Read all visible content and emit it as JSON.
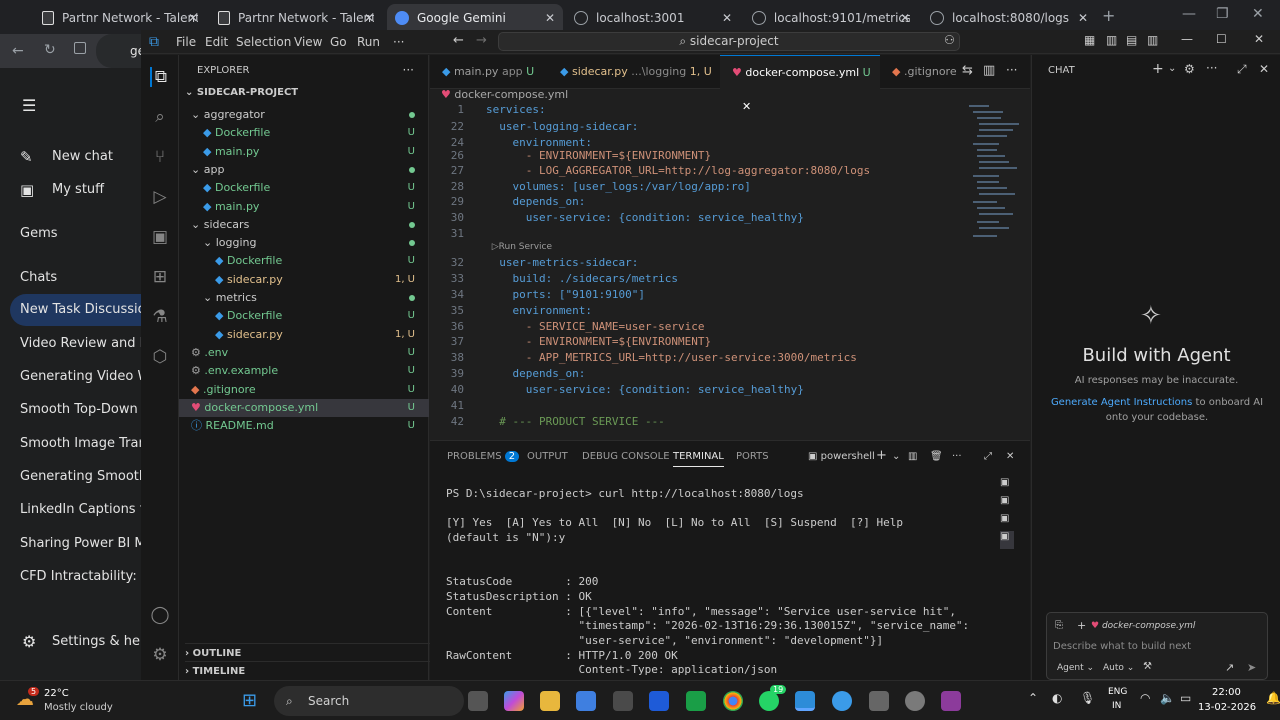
{
  "browser": {
    "tabs": [
      {
        "label": "Partnr Network - Talent Lay",
        "color": "#ffffff"
      },
      {
        "label": "Partnr Network - Talent Lay",
        "color": "#ffffff"
      },
      {
        "label": "Google Gemini",
        "color": "#4e8cf5"
      },
      {
        "label": "localhost:3001",
        "color": "#9aa0a6"
      },
      {
        "label": "localhost:9101/metrics",
        "color": "#9aa0a6"
      },
      {
        "label": "localhost:8080/logs",
        "color": "#9aa0a6"
      }
    ],
    "new_tab": "+",
    "address_partial": "ge"
  },
  "gemini": {
    "items": [
      "New chat",
      "My stuff",
      "Gems",
      "Chats"
    ],
    "chats": [
      "New Task Discussion",
      "Video Review and Enh",
      "Generating Video With",
      "Smooth Top-Down to",
      "Smooth Image Transiti",
      "Generating Smooth Ca",
      "LinkedIn Captions for",
      "Sharing Power BI Mod",
      "CFD Intractability: Gri"
    ],
    "settings": "Settings & help"
  },
  "vscode": {
    "menu": [
      "File",
      "Edit",
      "Selection",
      "View",
      "Go",
      "Run",
      "···"
    ],
    "command_center": "sidecar-project",
    "explorer_title": "EXPLORER",
    "project": "SIDECAR-PROJECT",
    "tree": [
      {
        "name": "aggregator",
        "indent": 1,
        "type": "folder",
        "status": "dot"
      },
      {
        "name": "Dockerfile",
        "indent": 2,
        "type": "docker",
        "status": "U"
      },
      {
        "name": "main.py",
        "indent": 2,
        "type": "py",
        "status": "U"
      },
      {
        "name": "app",
        "indent": 1,
        "type": "folder",
        "status": "dot"
      },
      {
        "name": "Dockerfile",
        "indent": 2,
        "type": "docker",
        "status": "U"
      },
      {
        "name": "main.py",
        "indent": 2,
        "type": "py",
        "status": "U"
      },
      {
        "name": "sidecars",
        "indent": 1,
        "type": "folder",
        "status": "dot"
      },
      {
        "name": "logging",
        "indent": 2,
        "type": "folder",
        "status": "dot"
      },
      {
        "name": "Dockerfile",
        "indent": 3,
        "type": "docker",
        "status": "U"
      },
      {
        "name": "sidecar.py",
        "indent": 3,
        "type": "py",
        "status": "1, U"
      },
      {
        "name": "metrics",
        "indent": 2,
        "type": "folder",
        "status": "dot"
      },
      {
        "name": "Dockerfile",
        "indent": 3,
        "type": "docker",
        "status": "U"
      },
      {
        "name": "sidecar.py",
        "indent": 3,
        "type": "py",
        "status": "1, U"
      },
      {
        "name": ".env",
        "indent": 1,
        "type": "gear",
        "status": "U"
      },
      {
        "name": ".env.example",
        "indent": 1,
        "type": "gear",
        "status": "U"
      },
      {
        "name": ".gitignore",
        "indent": 1,
        "type": "git",
        "status": "U"
      },
      {
        "name": "docker-compose.yml",
        "indent": 1,
        "type": "compose",
        "status": "U",
        "selected": true
      },
      {
        "name": "README.md",
        "indent": 1,
        "type": "info",
        "status": "U"
      }
    ],
    "outline": "OUTLINE",
    "timeline": "TIMELINE",
    "editor_tabs": [
      {
        "label": "main.py",
        "hint": "app",
        "status": "U"
      },
      {
        "label": "sidecar.py",
        "hint": "...\\logging",
        "status": "1, U"
      },
      {
        "label": "docker-compose.yml",
        "hint": "",
        "status": "U",
        "active": true
      },
      {
        "label": ".gitignore",
        "hint": "",
        "status": ""
      }
    ],
    "breadcrumb": "docker-compose.yml",
    "code": [
      {
        "n": "1",
        "t": "services:"
      },
      {
        "n": "22",
        "t": "  user-logging-sidecar:"
      },
      {
        "n": "24",
        "t": "    environment:"
      },
      {
        "n": "26",
        "t": "      - ENVIRONMENT=${ENVIRONMENT}"
      },
      {
        "n": "27",
        "t": "      - LOG_AGGREGATOR_URL=http://log-aggregator:8080/logs"
      },
      {
        "n": "28",
        "t": "    volumes: [user_logs:/var/log/app:ro]"
      },
      {
        "n": "29",
        "t": "    depends_on:"
      },
      {
        "n": "30",
        "t": "      user-service: {condition: service_healthy}"
      },
      {
        "n": "31",
        "t": ""
      },
      {
        "n": "",
        "t": "  ▷Run Service"
      },
      {
        "n": "32",
        "t": "  user-metrics-sidecar:"
      },
      {
        "n": "33",
        "t": "    build: ./sidecars/metrics"
      },
      {
        "n": "34",
        "t": "    ports: [\"9101:9100\"]"
      },
      {
        "n": "35",
        "t": "    environment:"
      },
      {
        "n": "36",
        "t": "      - SERVICE_NAME=user-service"
      },
      {
        "n": "37",
        "t": "      - ENVIRONMENT=${ENVIRONMENT}"
      },
      {
        "n": "38",
        "t": "      - APP_METRICS_URL=http://user-service:3000/metrics"
      },
      {
        "n": "39",
        "t": "    depends_on:"
      },
      {
        "n": "40",
        "t": "      user-service: {condition: service_healthy}"
      },
      {
        "n": "41",
        "t": ""
      },
      {
        "n": "42",
        "t": "  # --- PRODUCT SERVICE ---"
      }
    ],
    "panel_tabs": [
      "PROBLEMS",
      "OUTPUT",
      "DEBUG CONSOLE",
      "TERMINAL",
      "PORTS"
    ],
    "problems_count": "2",
    "shell": "powershell",
    "terminal": [
      "PS D:\\sidecar-project> curl http://localhost:8080/logs",
      "",
      "[Y] Yes  [A] Yes to All  [N] No  [L] No to All  [S] Suspend  [?] Help",
      "(default is \"N\"):y",
      "",
      "",
      "StatusCode        : 200",
      "StatusDescription : OK",
      "Content           : [{\"level\": \"info\", \"message\": \"Service user-service hit\",",
      "                    \"timestamp\": \"2026-02-13T16:29:36.130015Z\", \"service_name\":",
      "                    \"user-service\", \"environment\": \"development\"}]",
      "RawContent        : HTTP/1.0 200 OK",
      "                    Content-Type: application/json"
    ],
    "chat": {
      "title": "CHAT",
      "heading": "Build with Agent",
      "disclaimer": "AI responses may be inaccurate.",
      "link": "Generate Agent Instructions",
      "after_link": "to onboard AI onto your codebase.",
      "context_file": "docker-compose.yml",
      "placeholder": "Describe what to build next",
      "mode": "Agent",
      "model": "Auto"
    }
  },
  "taskbar": {
    "weather_temp": "22°C",
    "weather_desc": "Mostly cloudy",
    "weather_badge": "5",
    "search": "Search",
    "lang_top": "ENG",
    "lang_bottom": "IN",
    "time": "22:00",
    "date": "13-02-2026",
    "whatsapp_badge": "19"
  }
}
